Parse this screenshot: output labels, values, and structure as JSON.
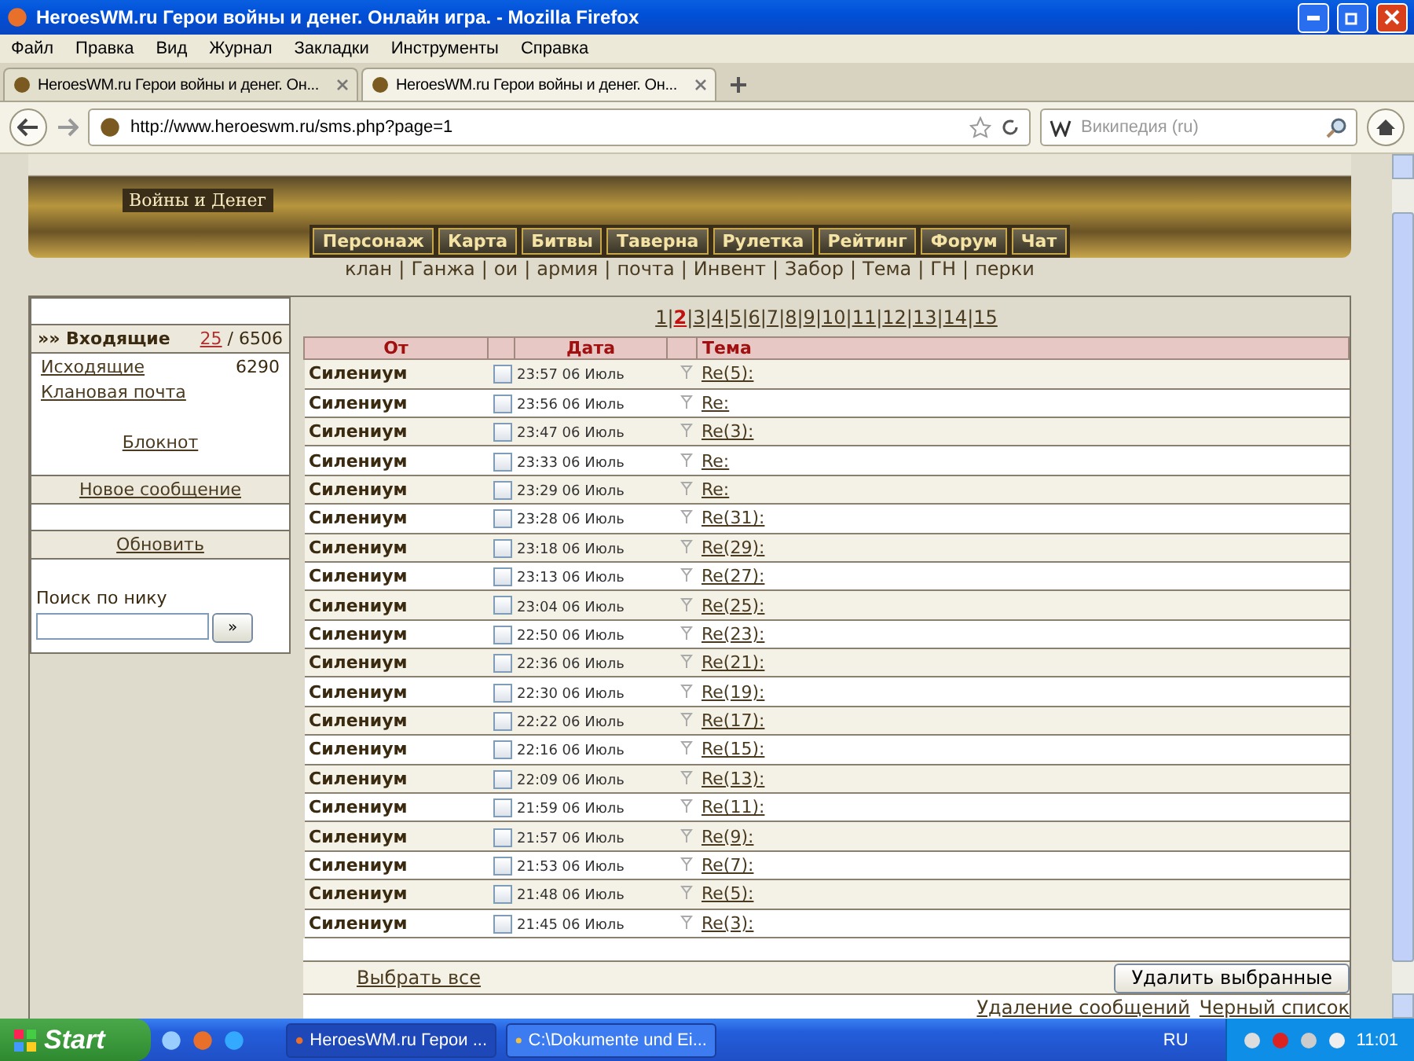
{
  "window": {
    "title": "HeroesWM.ru Герои войны и денег. Онлайн игра. - Mozilla Firefox"
  },
  "menu": [
    "Файл",
    "Правка",
    "Вид",
    "Журнал",
    "Закладки",
    "Инструменты",
    "Справка"
  ],
  "tabs": [
    {
      "label": "HeroesWM.ru Герои войны и денег. Он...",
      "selected": false
    },
    {
      "label": "HeroesWM.ru Герои войны и денег. Он...",
      "selected": true
    }
  ],
  "address": {
    "url": "http://www.heroeswm.ru/sms.php?page=1"
  },
  "search": {
    "placeholder": "Википедия (ru)"
  },
  "banner": {
    "logo_text": "Войны и Денег"
  },
  "game_nav": [
    "Персонаж",
    "Карта",
    "Битвы",
    "Таверна",
    "Рулетка",
    "Рейтинг",
    "Форум",
    "Чат"
  ],
  "link_separator": "|",
  "sub_links": [
    "клан",
    "Ганжа",
    "ои",
    "армия",
    "почта",
    "Инвент",
    "Забор",
    "Тема",
    "ГН",
    "перки"
  ],
  "pagination": [
    {
      "label": "1",
      "selected": false
    },
    {
      "label": "2",
      "selected": true
    },
    {
      "label": "3",
      "selected": false
    },
    {
      "label": "4",
      "selected": false
    },
    {
      "label": "5",
      "selected": false
    },
    {
      "label": "6",
      "selected": false
    },
    {
      "label": "7",
      "selected": false
    },
    {
      "label": "8",
      "selected": false
    },
    {
      "label": "9",
      "selected": false
    },
    {
      "label": "10",
      "selected": false
    },
    {
      "label": "11",
      "selected": false
    },
    {
      "label": "12",
      "selected": false
    },
    {
      "label": "13",
      "selected": false
    },
    {
      "label": "14",
      "selected": false
    },
    {
      "label": "15",
      "selected": false
    }
  ],
  "sidebar": {
    "inbox": {
      "label": "»» Входящие",
      "unread": "25",
      "total": "/ 6506"
    },
    "outgoing": {
      "label": "Исходящие",
      "count": "6290"
    },
    "clan_mail": "Клановая почта",
    "notepad": "Блокнот",
    "new_message": "Новое сообщение",
    "refresh": "Обновить",
    "search_label": "Поиск по нику",
    "search_button": "»"
  },
  "table": {
    "columns": [
      "От",
      "Дата",
      "Тема"
    ],
    "rows": [
      {
        "from": "Силениум",
        "checked": false,
        "date": "23:57 06 Июль",
        "subject": "Re(5):"
      },
      {
        "from": "Силениум",
        "checked": false,
        "date": "23:56 06 Июль",
        "subject": "Re:"
      },
      {
        "from": "Силениум",
        "checked": false,
        "date": "23:47 06 Июль",
        "subject": "Re(3):"
      },
      {
        "from": "Силениум",
        "checked": false,
        "date": "23:33 06 Июль",
        "subject": "Re:"
      },
      {
        "from": "Силениум",
        "checked": false,
        "date": "23:29 06 Июль",
        "subject": "Re:"
      },
      {
        "from": "Силениум",
        "checked": false,
        "date": "23:28 06 Июль",
        "subject": "Re(31):"
      },
      {
        "from": "Силениум",
        "checked": false,
        "date": "23:18 06 Июль",
        "subject": "Re(29):"
      },
      {
        "from": "Силениум",
        "checked": false,
        "date": "23:13 06 Июль",
        "subject": "Re(27):"
      },
      {
        "from": "Силениум",
        "checked": false,
        "date": "23:04 06 Июль",
        "subject": "Re(25):"
      },
      {
        "from": "Силениум",
        "checked": false,
        "date": "22:50 06 Июль",
        "subject": "Re(23):"
      },
      {
        "from": "Силениум",
        "checked": false,
        "date": "22:36 06 Июль",
        "subject": "Re(21):"
      },
      {
        "from": "Силениум",
        "checked": false,
        "date": "22:30 06 Июль",
        "subject": "Re(19):"
      },
      {
        "from": "Силениум",
        "checked": false,
        "date": "22:22 06 Июль",
        "subject": "Re(17):"
      },
      {
        "from": "Силениум",
        "checked": false,
        "date": "22:16 06 Июль",
        "subject": "Re(15):"
      },
      {
        "from": "Силениум",
        "checked": false,
        "date": "22:09 06 Июль",
        "subject": "Re(13):"
      },
      {
        "from": "Силениум",
        "checked": false,
        "date": "21:59 06 Июль",
        "subject": "Re(11):"
      },
      {
        "from": "Силениум",
        "checked": false,
        "date": "21:57 06 Июль",
        "subject": "Re(9):"
      },
      {
        "from": "Силениум",
        "checked": false,
        "date": "21:53 06 Июль",
        "subject": "Re(7):"
      },
      {
        "from": "Силениум",
        "checked": false,
        "date": "21:48 06 Июль",
        "subject": "Re(5):"
      },
      {
        "from": "Силениум",
        "checked": false,
        "date": "21:45 06 Июль",
        "subject": "Re(3):"
      }
    ],
    "select_all": "Выбрать все",
    "delete_button": "Удалить выбранные"
  },
  "footer_links": [
    "Удаление сообщений",
    "Черный список"
  ],
  "taskbar": {
    "start": "Start",
    "tasks": [
      {
        "label": "HeroesWM.ru Герои ...",
        "selected": true
      },
      {
        "label": "C:\\Dokumente und Ei...",
        "selected": false
      }
    ],
    "language": "RU",
    "clock": "11:01"
  }
}
